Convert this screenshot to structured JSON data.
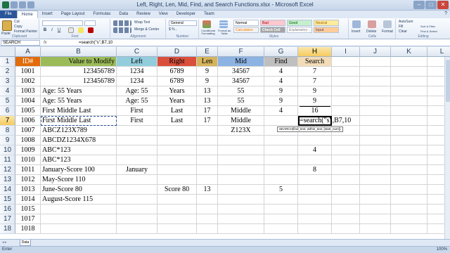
{
  "window": {
    "title": "Left, Right, Len, Mid, Find, and Search Functions.xlsx - Microsoft Excel",
    "controls": {
      "minimize": "–",
      "maximize": "□",
      "close": "✕"
    }
  },
  "tabs": [
    "File",
    "Home",
    "Insert",
    "Page Layout",
    "Formulas",
    "Data",
    "Review",
    "View",
    "Developer",
    "Team"
  ],
  "active_tab": "Home",
  "ribbon": {
    "clipboard": {
      "paste": "Paste",
      "cut": "Cut",
      "copy": "Copy",
      "format_painter": "Format Painter",
      "label": "Clipboard"
    },
    "font": {
      "name": "",
      "size": "",
      "bold": "B",
      "italic": "I",
      "underline": "U",
      "label": "Font"
    },
    "alignment": {
      "wrap": "Wrap Text",
      "merge": "Merge & Center",
      "label": "Alignment"
    },
    "number": {
      "format": "General",
      "label": "Number"
    },
    "styles": {
      "conditional": "Conditional Formatting",
      "table": "Format as Table",
      "chips": [
        "Normal",
        "Bad",
        "Good",
        "Neutral",
        "Calculation",
        "Check Cell",
        "Explanatory ...",
        "Input"
      ],
      "label": "Styles"
    },
    "cells": {
      "insert": "Insert",
      "delete": "Delete",
      "format": "Format",
      "label": "Cells"
    },
    "editing": {
      "autosum": "AutoSum",
      "fill": "Fill",
      "clear": "Clear",
      "sort": "Sort & Filter",
      "find": "Find & Select",
      "label": "Editing"
    }
  },
  "formula_bar": {
    "name_box": "SEARCH",
    "fx": "fx",
    "formula": "=search(\"s\",B7,10"
  },
  "columns": [
    "A",
    "B",
    "C",
    "D",
    "E",
    "F",
    "G",
    "H",
    "I",
    "J",
    "K",
    "L"
  ],
  "selected_column": "H",
  "selected_row": "7",
  "row_numbers": [
    "1",
    "2",
    "3",
    "4",
    "5",
    "6",
    "7",
    "8",
    "9",
    "10",
    "11",
    "12",
    "13",
    "14",
    "15",
    "16",
    "17",
    "18"
  ],
  "rows": [
    [
      "ID#",
      "Value to Modify",
      "Left",
      "Right",
      "Len",
      "Mid",
      "Find",
      "Search"
    ],
    [
      "1001",
      "123456789",
      "1234",
      "6789",
      "9",
      "34567",
      "4",
      "7"
    ],
    [
      "1002",
      "123456789",
      "1234",
      "6789",
      "9",
      "34567",
      "4",
      "7"
    ],
    [
      "1003",
      "Age: 55 Years",
      "Age: 55",
      "Years",
      "13",
      "55",
      "9",
      "9"
    ],
    [
      "1004",
      "Age: 55 Years",
      "Age: 55",
      "Years",
      "13",
      "55",
      "9",
      "9"
    ],
    [
      "1005",
      "First Middle Last",
      "First",
      "Last",
      "17",
      "Middle",
      "4",
      "16"
    ],
    [
      "1006",
      "First Middle Last",
      "First",
      "Last",
      "17",
      "Middle",
      "",
      "=search(\"s\",B7,10"
    ],
    [
      "1007",
      "ABCZ123X789",
      "",
      "",
      "",
      "Z123X",
      "",
      ""
    ],
    [
      "1008",
      "ABCDZ1234X678",
      "",
      "",
      "",
      "",
      "",
      ""
    ],
    [
      "1009",
      "ABC*123",
      "",
      "",
      "",
      "",
      "",
      "4"
    ],
    [
      "1010",
      "ABC*123",
      "",
      "",
      "",
      "",
      "",
      ""
    ],
    [
      "1011",
      "January-Score 100",
      "January",
      "",
      "",
      "",
      "",
      "8"
    ],
    [
      "1012",
      "May-Score 110",
      "",
      "",
      "",
      "",
      "",
      ""
    ],
    [
      "1013",
      "June-Score 80",
      "",
      "Score 80",
      "13",
      "",
      "5",
      ""
    ],
    [
      "1014",
      "August-Score 115",
      "",
      "",
      "",
      "",
      "",
      ""
    ],
    [
      "1015",
      "",
      "",
      "",
      "",
      "",
      "",
      ""
    ],
    [
      "1017",
      "",
      "",
      "",
      "",
      "",
      "",
      ""
    ],
    [
      "1018",
      "",
      "",
      "",
      "",
      "",
      "",
      ""
    ]
  ],
  "header_colors": {
    "A": "#e26b0a",
    "B": "#9bbb59",
    "C": "#92cddc",
    "D": "#da4f3c",
    "E": "#d5b45c",
    "F": "#8db3e2",
    "G": "#bfbfbf",
    "H": "#f2dcb7"
  },
  "tooltip": "SEARCH(find_text, within_text, [start_num])",
  "sheet_tab": "Data",
  "status": {
    "mode": "Enter",
    "zoom": "100%"
  }
}
